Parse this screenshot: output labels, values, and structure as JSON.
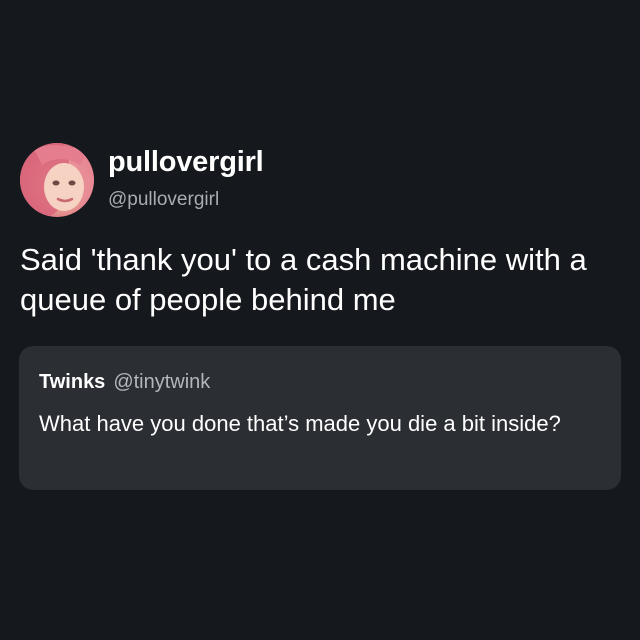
{
  "tweet": {
    "author": {
      "display_name": "pullovergirl",
      "handle": "@pullovergirl",
      "avatar_icon": "profile-photo-avatar"
    },
    "text": "Said 'thank you' to a cash machine with a queue of people behind me"
  },
  "quoted_tweet": {
    "display_name": "Twinks",
    "handle": "@tinytwink",
    "text": "What have you done that’s made you die a bit inside?"
  },
  "colors": {
    "background": "#15181c",
    "card": "#2b2e33",
    "secondary_text": "#a8adb3",
    "primary_text": "#ffffff"
  }
}
